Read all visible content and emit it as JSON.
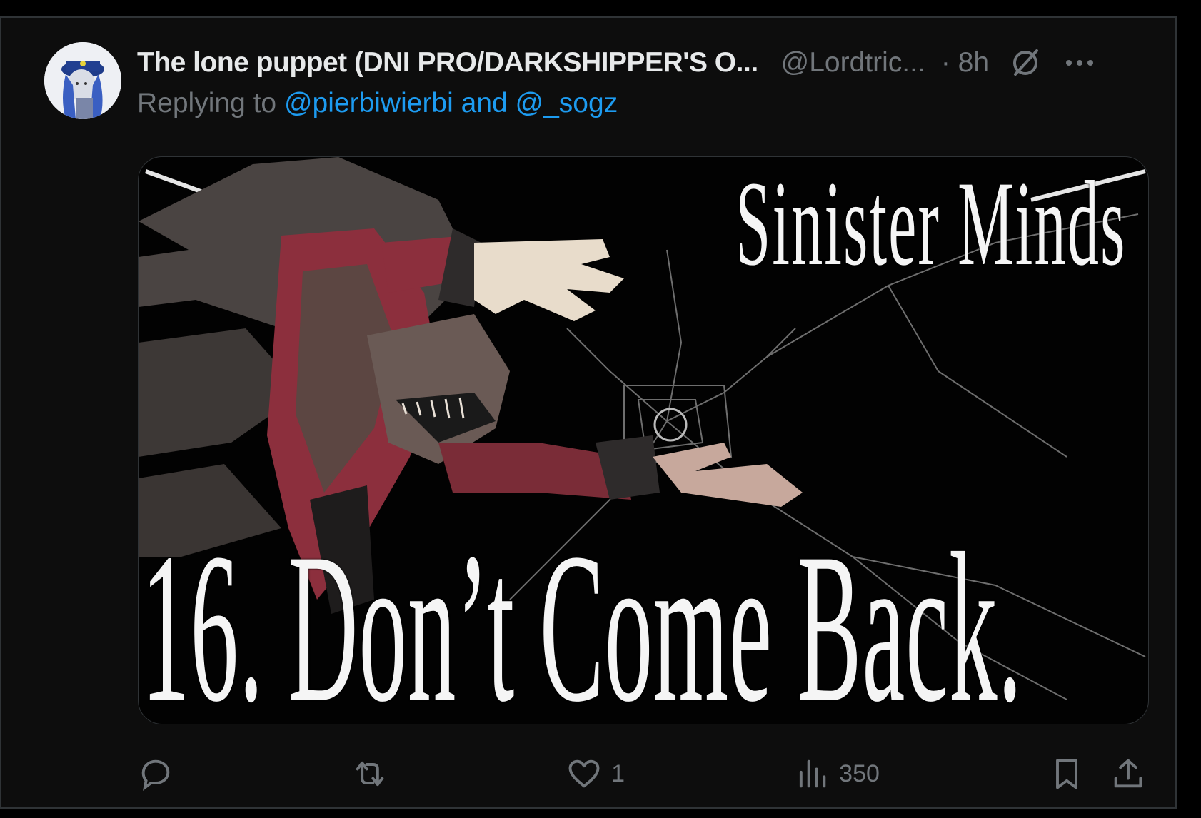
{
  "post": {
    "author_name": "The lone puppet (DNI PRO/DARKSHIPPER'S O...",
    "handle": "@Lordtric...",
    "time": "· 8h",
    "replying_prefix": "Replying to ",
    "mentions": "@pierbiwierbi and @_sogz",
    "media": {
      "title_text": "Sinister Minds",
      "track_text": "16. Don’t Come Back."
    },
    "actions": {
      "reply_count": "",
      "repost_count": "",
      "like_count": "1",
      "views_count": "350"
    }
  },
  "icons": [
    "avatar",
    "grok-icon",
    "more-icon",
    "reply-icon",
    "repost-icon",
    "like-icon",
    "views-icon",
    "bookmark-icon",
    "share-icon"
  ],
  "colors": {
    "background": "#000000",
    "text": "#e7e9ea",
    "muted": "#71767b",
    "accent": "#1d9bf0"
  }
}
